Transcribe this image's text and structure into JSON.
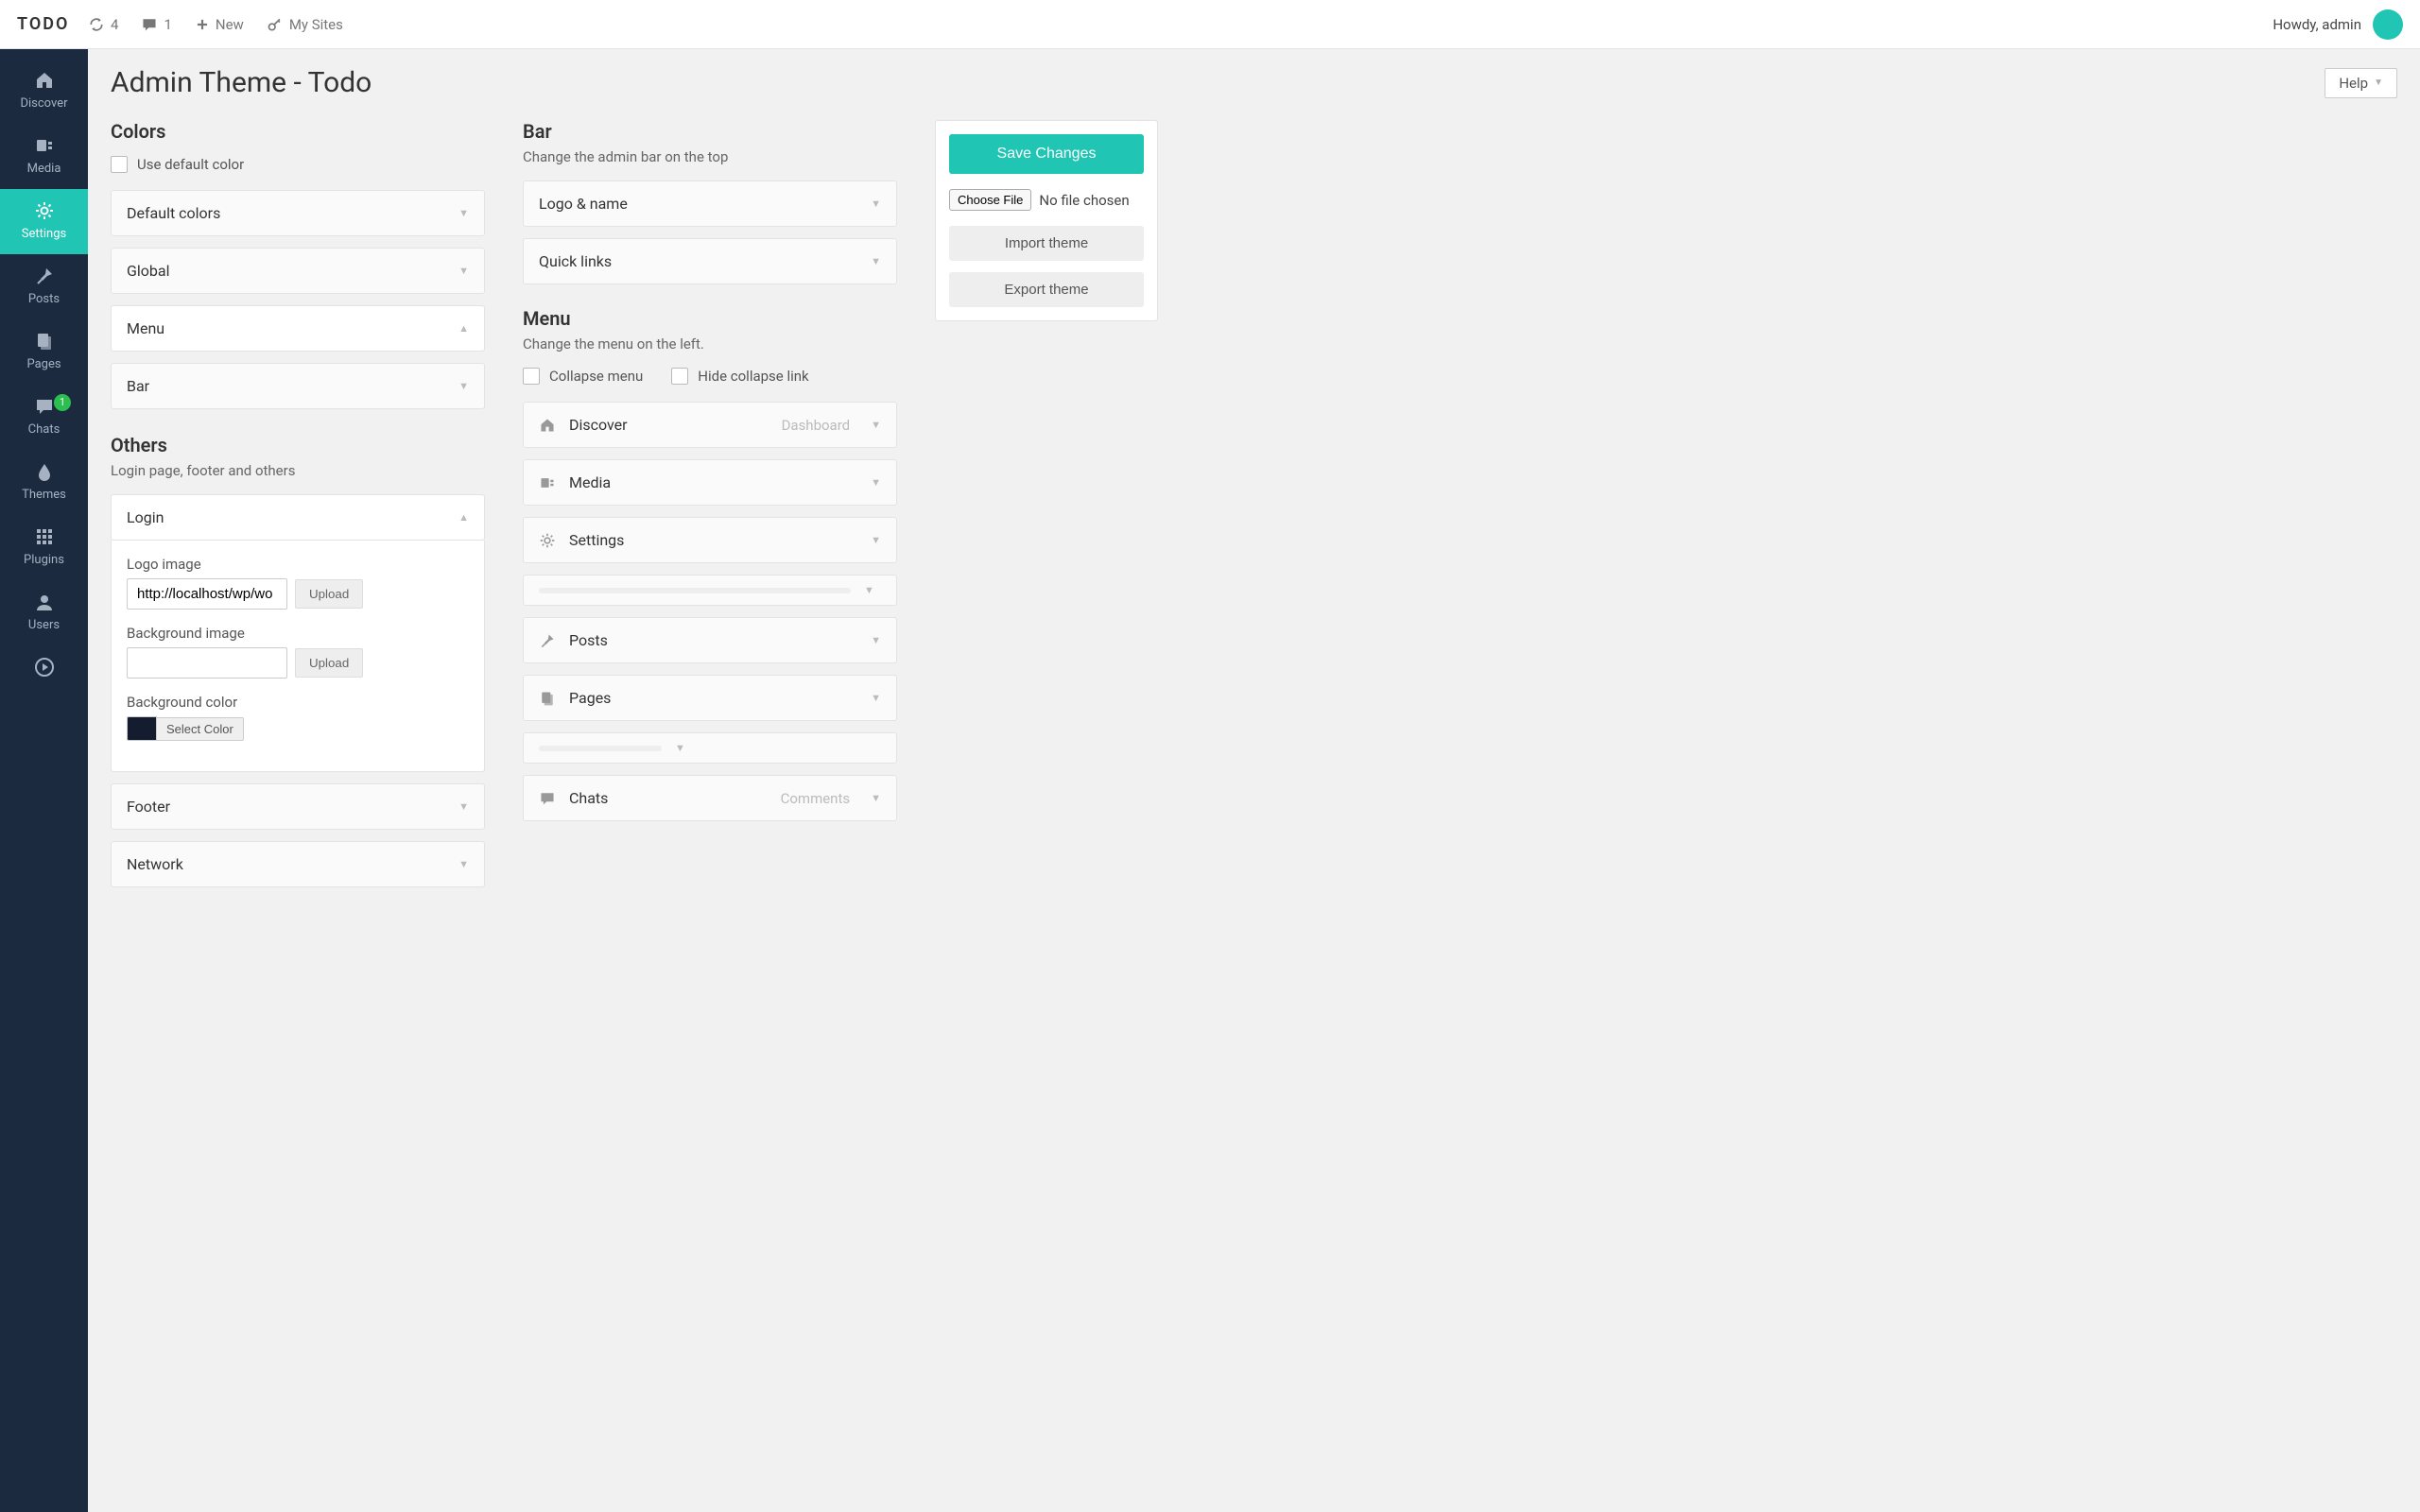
{
  "brand": "TODO",
  "topbar": {
    "refresh_count": "4",
    "comment_count": "1",
    "new_label": "New",
    "mysites_label": "My Sites",
    "howdy": "Howdy, admin"
  },
  "help_label": "Help",
  "page_title": "Admin Theme - Todo",
  "sidebar": [
    {
      "label": "Discover",
      "icon": "home",
      "active": false
    },
    {
      "label": "Media",
      "icon": "media",
      "active": false
    },
    {
      "label": "Settings",
      "icon": "gear",
      "active": true
    },
    {
      "label": "Posts",
      "icon": "pin",
      "active": false
    },
    {
      "label": "Pages",
      "icon": "pages",
      "active": false
    },
    {
      "label": "Chats",
      "icon": "chat",
      "active": false,
      "badge": "1"
    },
    {
      "label": "Themes",
      "icon": "drop",
      "active": false
    },
    {
      "label": "Plugins",
      "icon": "grid",
      "active": false
    },
    {
      "label": "Users",
      "icon": "user",
      "active": false
    },
    {
      "label": "",
      "icon": "play",
      "active": false
    }
  ],
  "colors": {
    "heading": "Colors",
    "use_default": "Use default color",
    "accordions": [
      {
        "title": "Default colors",
        "open": false
      },
      {
        "title": "Global",
        "open": false
      },
      {
        "title": "Menu",
        "open": true
      },
      {
        "title": "Bar",
        "open": false
      }
    ]
  },
  "others": {
    "heading": "Others",
    "sub": "Login page, footer and others",
    "login": {
      "title": "Login",
      "logo_label": "Logo image",
      "logo_value": "http://localhost/wp/wo",
      "bg_image_label": "Background image",
      "bg_image_value": "",
      "bg_color_label": "Background color",
      "upload": "Upload",
      "select_color": "Select Color"
    },
    "footer": "Footer",
    "network": "Network"
  },
  "bar": {
    "heading": "Bar",
    "sub": "Change the admin bar on the top",
    "accordions": [
      "Logo & name",
      "Quick links"
    ]
  },
  "menu": {
    "heading": "Menu",
    "sub": "Change the menu on the left.",
    "collapse": "Collapse menu",
    "hide_collapse": "Hide collapse link",
    "items": [
      {
        "icon": "home",
        "label": "Discover",
        "alt": "Dashboard"
      },
      {
        "icon": "media",
        "label": "Media"
      },
      {
        "icon": "gear",
        "label": "Settings"
      },
      {
        "icon": null,
        "label": null
      },
      {
        "icon": "pin",
        "label": "Posts"
      },
      {
        "icon": "pages",
        "label": "Pages"
      },
      {
        "icon": null,
        "label": null,
        "short": true
      },
      {
        "icon": "chat",
        "label": "Chats",
        "alt": "Comments"
      }
    ]
  },
  "actions": {
    "save": "Save Changes",
    "choose_file": "Choose File",
    "no_file": "No file chosen",
    "import": "Import theme",
    "export": "Export theme"
  }
}
